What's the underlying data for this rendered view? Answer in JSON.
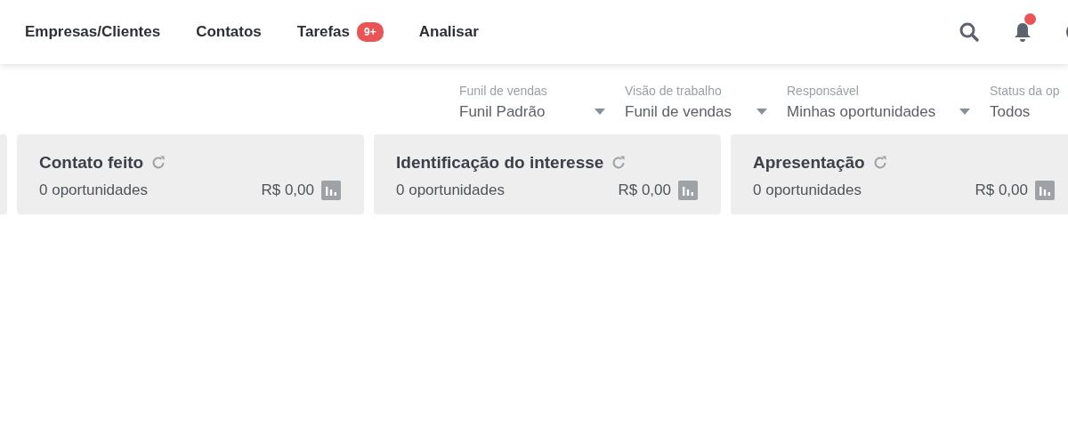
{
  "nav": {
    "items": [
      {
        "label": "Empresas/Clientes"
      },
      {
        "label": "Contatos"
      },
      {
        "label": "Tarefas",
        "badge": "9+"
      },
      {
        "label": "Analisar"
      }
    ],
    "notifications_unread": true
  },
  "filters": [
    {
      "label": "Funil de vendas",
      "value": "Funil Padrão",
      "dropdown": true
    },
    {
      "label": "Visão de trabalho",
      "value": "Funil de vendas",
      "dropdown": true
    },
    {
      "label": "Responsável",
      "value": "Minhas oportunidades",
      "dropdown": true
    },
    {
      "label": "Status da op",
      "value": "Todos"
    }
  ],
  "stages": [
    {
      "kind": "partial"
    },
    {
      "kind": "stage",
      "title": "Contato feito",
      "count": "0 oportunidades",
      "amount": "R$ 0,00"
    },
    {
      "kind": "stage",
      "title": "Identificação do interesse",
      "count": "0 oportunidades",
      "amount": "R$ 0,00"
    },
    {
      "kind": "stage",
      "title": "Apresentação",
      "count": "0 oportunidades",
      "amount": "R$ 0,00"
    }
  ]
}
